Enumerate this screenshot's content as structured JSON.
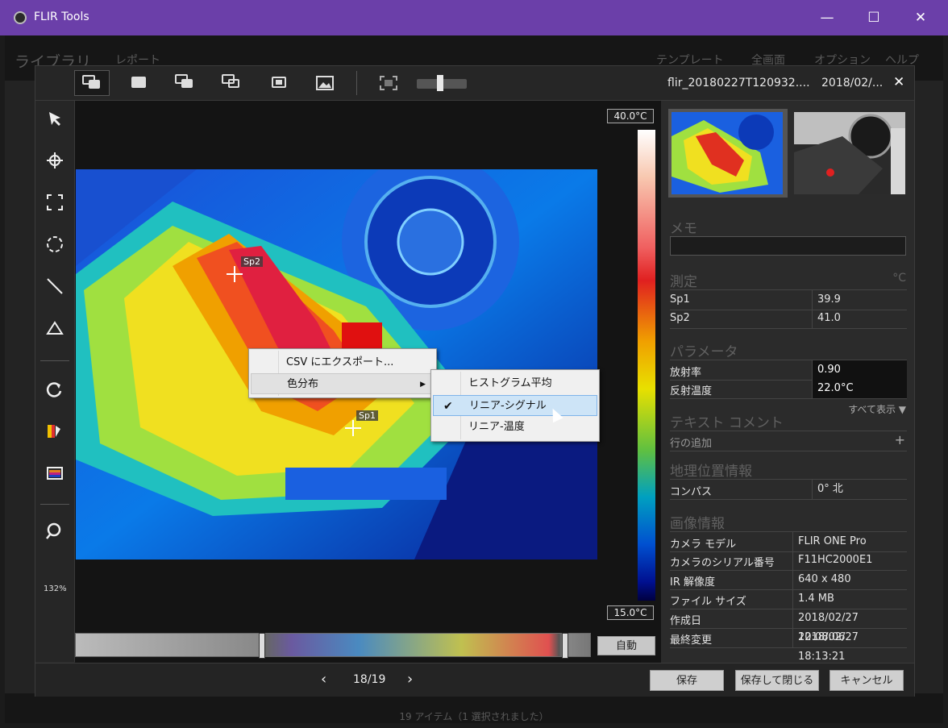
{
  "window": {
    "title": "FLIR Tools",
    "minimize": "—",
    "maximize": "☐",
    "close": "✕"
  },
  "background_app": {
    "nav_library": "ライブラリ",
    "nav_report": "レポート",
    "nav_template": "テンプレート",
    "nav_fullscreen": "全画面",
    "nav_options": "オプション",
    "nav_help": "ヘルプ",
    "status": "19 アイテム（1 選択されました）"
  },
  "dialog": {
    "filename": "flir_20180227T120932....",
    "filedate": "2018/02/...",
    "close": "✕",
    "zoom_label": "132%",
    "scale_max": "40.0°C",
    "scale_min": "15.0°C",
    "auto_button": "自動",
    "spots": {
      "sp1": "Sp1",
      "sp2": "Sp2"
    },
    "context_menu": {
      "export_csv": "CSV にエクスポート...",
      "color_distribution": "色分布",
      "submenu": [
        {
          "label": "ヒストグラム平均",
          "checked": false
        },
        {
          "label": "リニア-シグナル",
          "checked": true
        },
        {
          "label": "リニア-温度",
          "checked": false
        }
      ],
      "check_mark": "✔"
    },
    "panel": {
      "memo_title": "メモ",
      "measure_title": "測定",
      "measure_unit": "°C",
      "measurements": [
        {
          "name": "Sp1",
          "value": "39.9"
        },
        {
          "name": "Sp2",
          "value": "41.0"
        }
      ],
      "params_title": "パラメータ",
      "params": [
        {
          "name": "放射率",
          "value": "0.90"
        },
        {
          "name": "反射温度",
          "value": "22.0°C"
        }
      ],
      "show_all": "すべて表示 ▼",
      "text_comment_title": "テキスト コメント",
      "add_row": "行の追加",
      "add_plus": "+",
      "geo_title": "地理位置情報",
      "geo": [
        {
          "name": "コンパス",
          "value": "0° 北"
        }
      ],
      "image_info_title": "画像情報",
      "image_info": [
        {
          "name": "カメラ モデル",
          "value": "FLIR ONE Pro"
        },
        {
          "name": "カメラのシリアル番号",
          "value": "F11HC2000E1"
        },
        {
          "name": "IR 解像度",
          "value": "640 x 480"
        },
        {
          "name": "ファイル サイズ",
          "value": "1.4 MB"
        },
        {
          "name": "作成日",
          "value": "2018/02/27 12:08:06"
        },
        {
          "name": "最終変更",
          "value": "2018/02/27 18:13:21"
        }
      ]
    },
    "pager": {
      "prev": "‹",
      "current": "18/19",
      "next": "›"
    },
    "buttons": {
      "save": "保存",
      "save_close": "保存して閉じる",
      "cancel": "キャンセル"
    }
  },
  "colors": {
    "titlebar": "#6b3fa9",
    "menu_highlight": "#cde4f7"
  }
}
